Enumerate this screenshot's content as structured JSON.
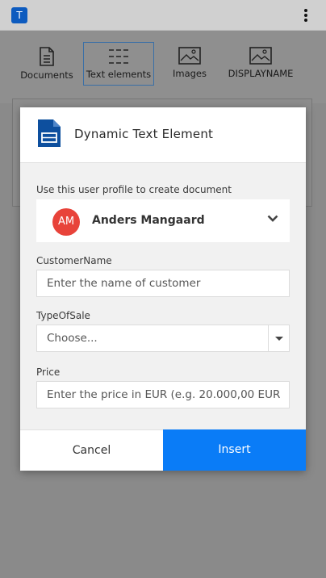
{
  "app": {
    "logo_letter": "T",
    "icon_names": {
      "menu": "more-vertical-icon"
    }
  },
  "toolbar": {
    "items": [
      {
        "label": "Documents",
        "icon": "document-icon",
        "active": false
      },
      {
        "label": "Text elements",
        "icon": "text-elements-icon",
        "active": true
      },
      {
        "label": "Images",
        "icon": "image-icon",
        "active": false
      },
      {
        "label": "DISPLAYNAME",
        "icon": "image-icon",
        "active": false
      }
    ]
  },
  "dialog": {
    "title": "Dynamic Text Element",
    "profile_label": "Use this user profile to create document",
    "profile": {
      "initials": "AM",
      "name": "Anders Mangaard",
      "avatar_color": "#e8433a"
    },
    "fields": {
      "customer_name": {
        "label": "CustomerName",
        "placeholder": "Enter the name of customer",
        "value": ""
      },
      "type_of_sale": {
        "label": "TypeOfSale",
        "selected": "Choose..."
      },
      "price": {
        "label": "Price",
        "placeholder": "Enter the price in EUR (e.g. 20.000,00 EUR",
        "value": ""
      }
    },
    "buttons": {
      "cancel": "Cancel",
      "insert": "Insert"
    }
  },
  "colors": {
    "accent": "#0a7cf7",
    "brand": "#0d5bbf",
    "overlay": "#8a8a8a"
  }
}
